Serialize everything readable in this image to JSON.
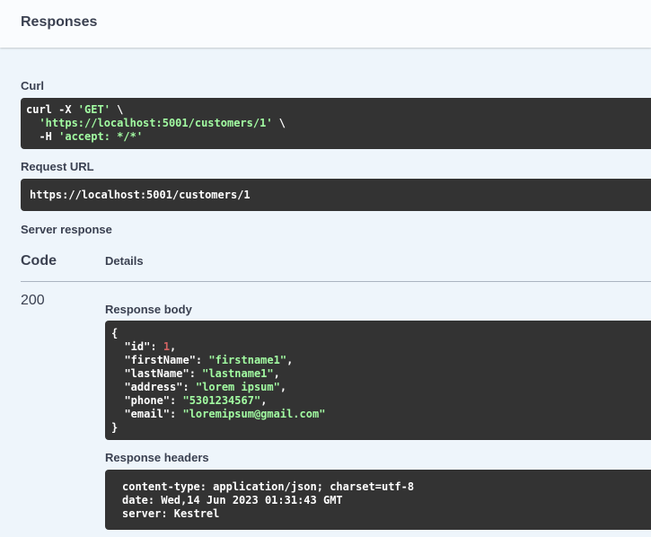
{
  "section_title": "Responses",
  "curl": {
    "label": "Curl",
    "cmd": "curl -X ",
    "method": "'GET'",
    "cont1": " \\",
    "indent": "  ",
    "url": "'https://localhost:5001/customers/1'",
    "cont2": " \\",
    "header_flag": "  -H ",
    "header_value": "'accept: */*'"
  },
  "request_url": {
    "label": "Request URL",
    "value": "https://localhost:5001/customers/1"
  },
  "server_response": {
    "label": "Server response",
    "col_code": "Code",
    "col_details": "Details",
    "status_code": "200"
  },
  "response_body": {
    "label": "Response body",
    "open": "{",
    "close": "}",
    "fields": [
      {
        "key": "  \"id\"",
        "sep": ": ",
        "value": "1",
        "type": "num",
        "comma": ","
      },
      {
        "key": "  \"firstName\"",
        "sep": ": ",
        "value": "\"firstname1\"",
        "type": "str",
        "comma": ","
      },
      {
        "key": "  \"lastName\"",
        "sep": ": ",
        "value": "\"lastname1\"",
        "type": "str",
        "comma": ","
      },
      {
        "key": "  \"address\"",
        "sep": ": ",
        "value": "\"lorem ipsum\"",
        "type": "str",
        "comma": ","
      },
      {
        "key": "  \"phone\"",
        "sep": ": ",
        "value": "\"5301234567\"",
        "type": "str",
        "comma": ","
      },
      {
        "key": "  \"email\"",
        "sep": ": ",
        "value": "\"loremipsum@gmail.com\"",
        "type": "str",
        "comma": ""
      }
    ]
  },
  "response_headers": {
    "label": "Response headers",
    "lines": [
      "content-type: application/json; charset=utf-8",
      "date: Wed,14 Jun 2023 01:31:43 GMT",
      "server: Kestrel"
    ]
  },
  "colors": {
    "background": "#eef5fb",
    "code_bg": "#333333",
    "string": "#a2fca2",
    "number": "#d36363"
  }
}
